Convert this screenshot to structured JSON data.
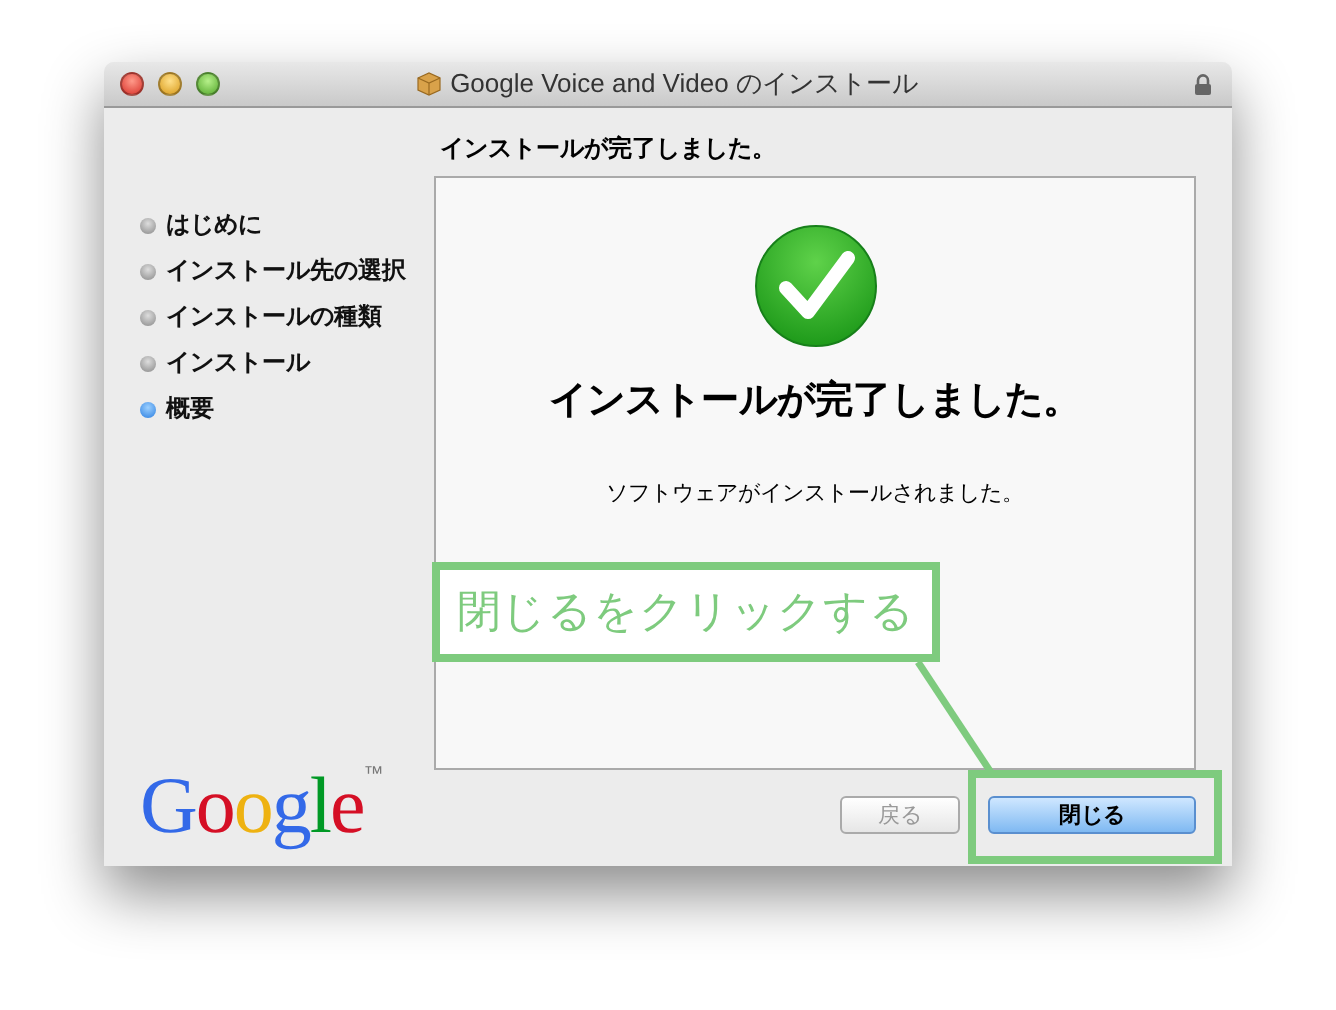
{
  "window": {
    "title": "Google Voice and Video のインストール"
  },
  "heading": "インストールが完了しました。",
  "steps": [
    {
      "label": "はじめに",
      "selected": false
    },
    {
      "label": "インストール先の選択",
      "selected": false
    },
    {
      "label": "インストールの種類",
      "selected": false
    },
    {
      "label": "インストール",
      "selected": false
    },
    {
      "label": "概要",
      "selected": true
    }
  ],
  "logo": {
    "text": "Google",
    "mark": "™"
  },
  "content": {
    "title": "インストールが完了しました。",
    "message": "ソフトウェアがインストールされました。"
  },
  "buttons": [
    {
      "label": "戻る",
      "disabled": true,
      "default": false
    },
    {
      "label": "閉じる",
      "disabled": false,
      "default": true
    }
  ],
  "annotation": {
    "text": "閉じるをクリックする"
  }
}
